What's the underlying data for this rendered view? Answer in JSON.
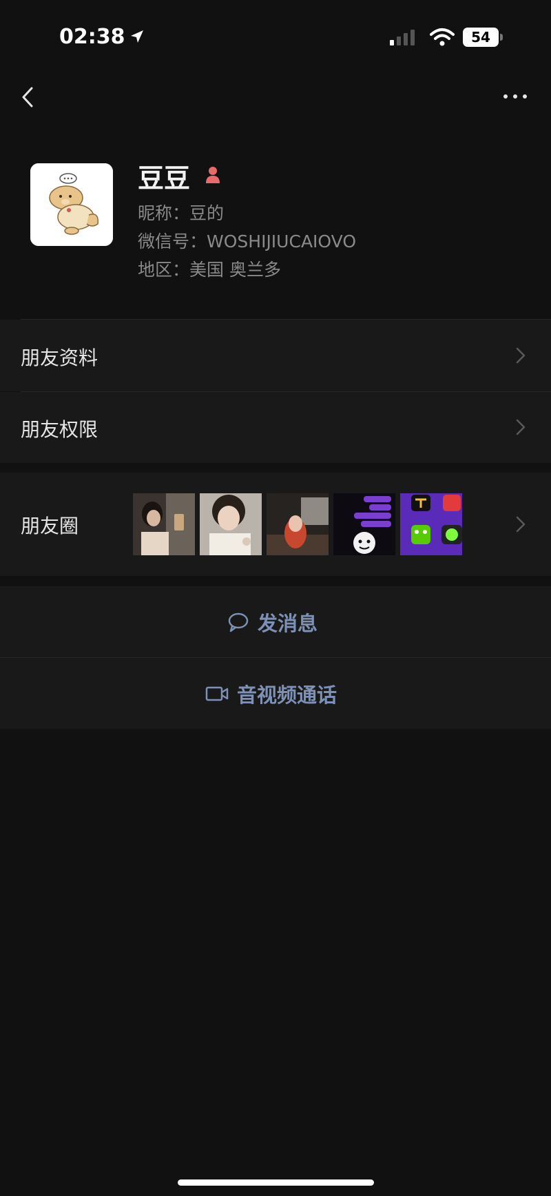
{
  "status_bar": {
    "time": "02:38",
    "battery": "54"
  },
  "profile": {
    "name": "豆豆",
    "nickname": "昵称：豆的",
    "wechat_id": "微信号：WOSHIJIUCAIOVO",
    "region": "地区：美国 奥兰多",
    "gender": "female"
  },
  "menu": {
    "friend_profile": "朋友资料",
    "friend_permissions": "朋友权限",
    "moments": "朋友圈"
  },
  "moments_thumbnails": [
    {
      "name": "moments-photo-1",
      "desc": "selfie"
    },
    {
      "name": "moments-photo-2",
      "desc": "selfie"
    },
    {
      "name": "moments-photo-3",
      "desc": "photo"
    },
    {
      "name": "moments-photo-4",
      "desc": "chat screenshot"
    },
    {
      "name": "moments-photo-5",
      "desc": "app screenshot"
    }
  ],
  "actions": {
    "message": "发消息",
    "call": "音视频通话"
  },
  "colors": {
    "background": "#111111",
    "row_background": "#191919",
    "action_text": "#7d90b6",
    "secondary_text": "#8a8a8a"
  }
}
